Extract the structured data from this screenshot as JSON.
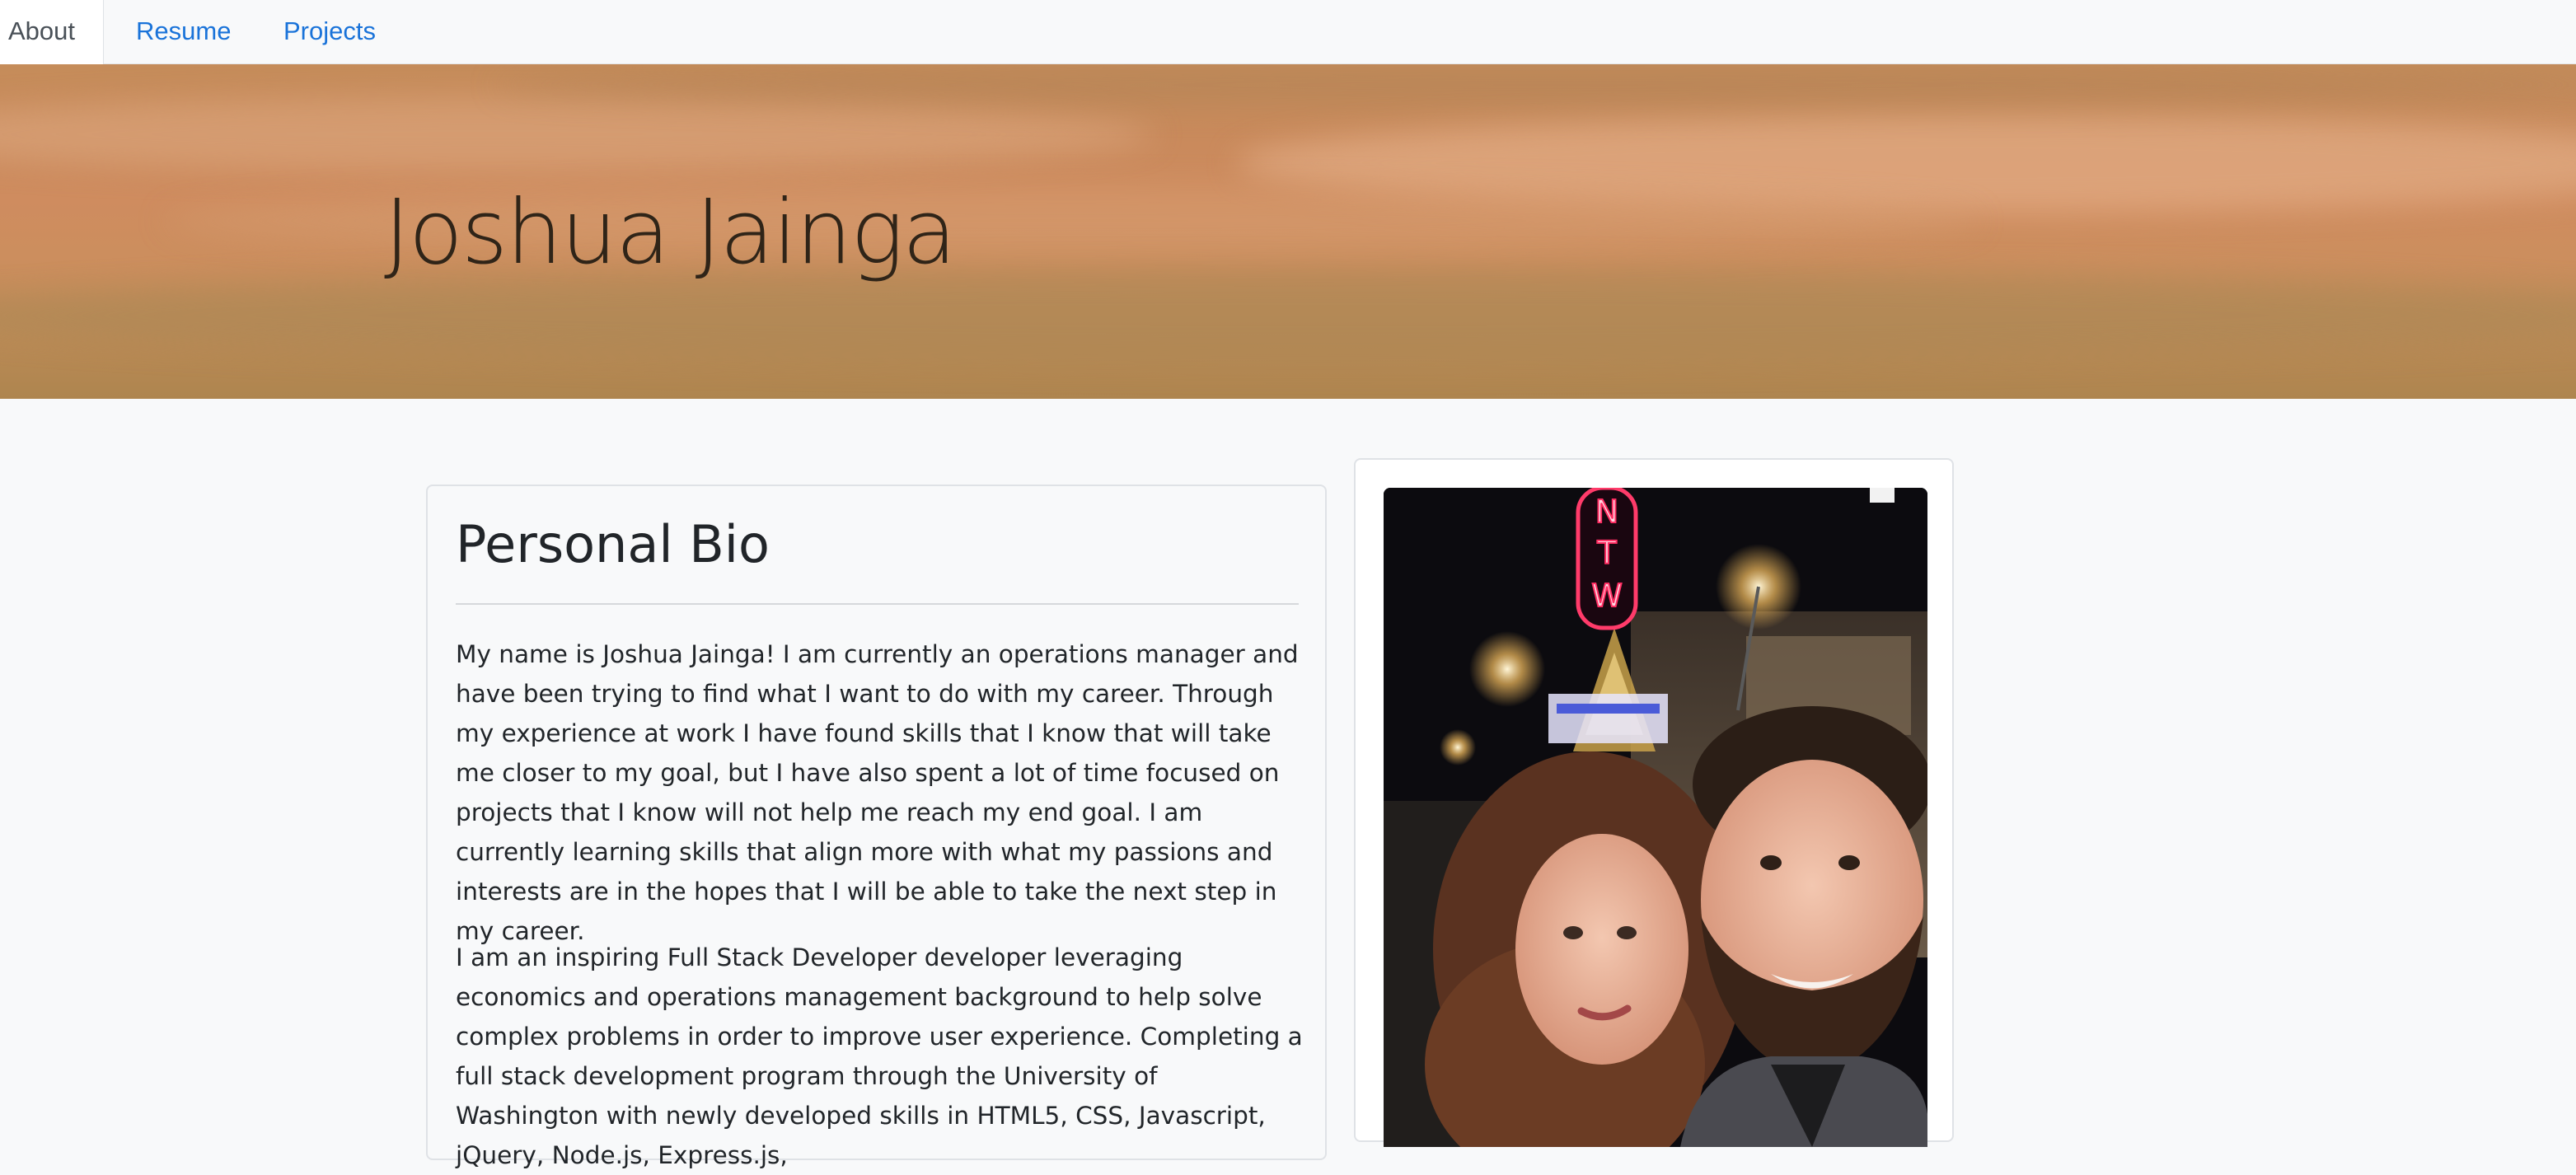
{
  "nav": {
    "items": [
      {
        "label": "About",
        "active": true
      },
      {
        "label": "Resume",
        "active": false
      },
      {
        "label": "Projects",
        "active": false
      }
    ]
  },
  "hero": {
    "title": "Joshua Jainga"
  },
  "bio": {
    "heading": "Personal Bio",
    "paragraph1": "My name is Joshua Jainga! I am currently an operations manager and have been trying to find what I want to do with my career. Through my experience at work I have found skills that I know that will take me closer to my goal, but I have also spent a lot of time focused on projects that I know will not help me reach my end goal. I am currently learning skills that align more with what my passions and interests are in the hopes that I will be able to take the next step in my career.",
    "paragraph2": "I am an inspiring Full Stack Developer developer leveraging economics and operations management background to help solve complex problems in order to improve user experience. Completing a full stack development program through the University of Washington with newly developed skills in HTML5, CSS, Javascript, jQuery, Node.js, Express.js,"
  },
  "photo": {
    "sign_letters": "NTW"
  },
  "colors": {
    "link": "#1a73d9",
    "text": "#212529",
    "page_bg": "#f8f9fa",
    "hero_tone": "#c98a5c"
  }
}
